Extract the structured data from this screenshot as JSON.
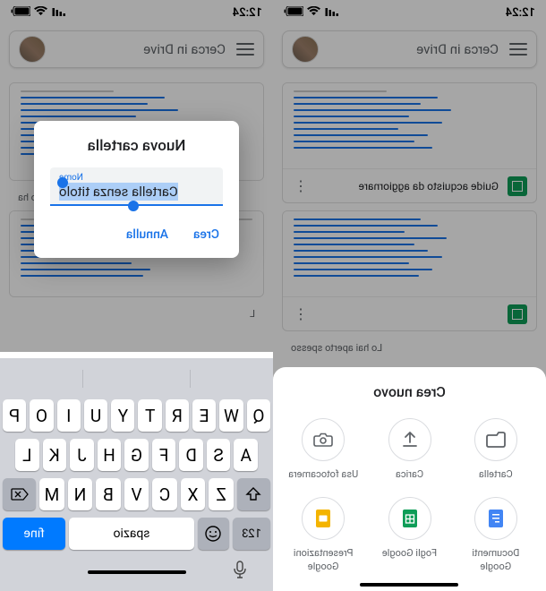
{
  "status": {
    "time": "12:24",
    "signal_icon": "signal-icon",
    "wifi_icon": "wifi-icon",
    "battery_icon": "battery-icon"
  },
  "search": {
    "placeholder": "Cerca in Drive"
  },
  "docs": {
    "item1_title": "Guide acquisto da aggiornare",
    "subtitle": "Lo hai aperto spesso"
  },
  "bottom_sheet": {
    "title": "Crea nuovo",
    "items": [
      {
        "label": "Cartella"
      },
      {
        "label": "Carica"
      },
      {
        "label": "Usa fotocamera"
      },
      {
        "label": "Documenti Google"
      },
      {
        "label": "Fogli Google"
      },
      {
        "label": "Presentazioni Google"
      }
    ]
  },
  "dialog": {
    "title": "Nuova cartella",
    "field_label": "Nome",
    "field_value": "Cartella senza titolo",
    "cancel": "Annulla",
    "create": "Crea"
  },
  "keyboard": {
    "row1": [
      "Q",
      "W",
      "E",
      "R",
      "T",
      "Y",
      "U",
      "I",
      "O",
      "P"
    ],
    "row2": [
      "A",
      "S",
      "D",
      "F",
      "G",
      "H",
      "J",
      "K",
      "L"
    ],
    "row3": [
      "Z",
      "X",
      "C",
      "V",
      "B",
      "N",
      "M"
    ],
    "numbers": "123",
    "space": "spazio",
    "done": "fine",
    "shift": "⇧",
    "backspace": "⌫",
    "emoji": "☺",
    "mic": "🎤"
  }
}
